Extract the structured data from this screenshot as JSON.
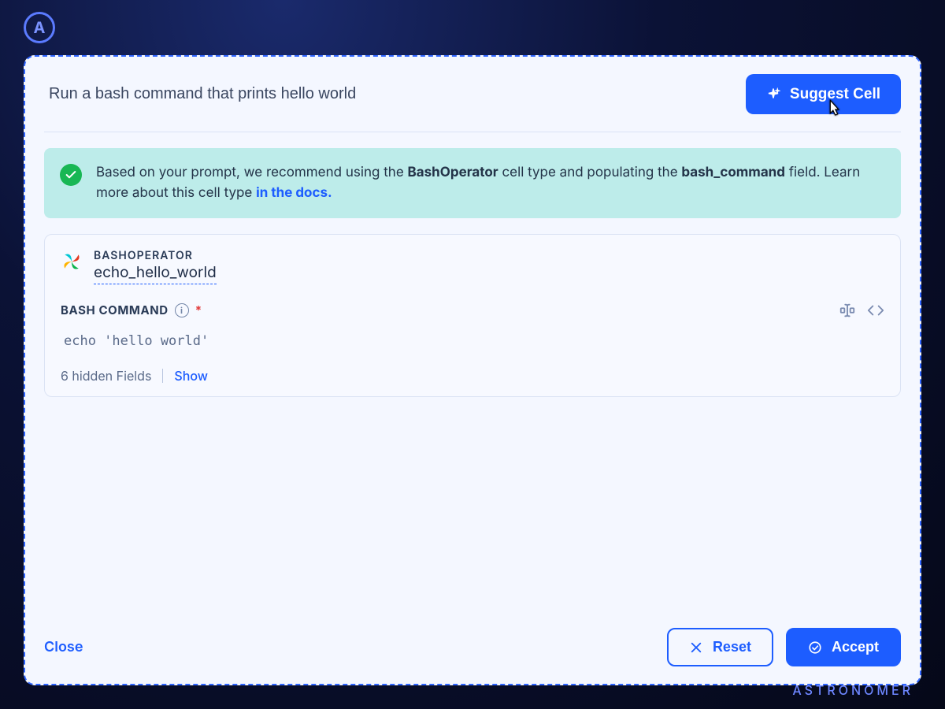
{
  "brand": {
    "logo_letter": "A",
    "footer_text": "ASTRONOMER"
  },
  "prompt": {
    "value": "Run a bash command that prints hello world",
    "suggest_label": "Suggest Cell"
  },
  "recommendation": {
    "prefix": "Based on your prompt, we recommend using the ",
    "cell_type_bold": "BashOperator",
    "mid1": " cell type and populating the ",
    "field_bold": "bash_command",
    "mid2": " field. Learn more about this cell type ",
    "link_text": "in the docs."
  },
  "cell": {
    "type_label": "BASHOPERATOR",
    "task_name": "echo_hello_world",
    "field": {
      "label": "BASH COMMAND",
      "required_mark": "*",
      "value": "echo 'hello world'"
    },
    "hidden_fields_text": "6 hidden Fields",
    "show_link": "Show"
  },
  "footer": {
    "close": "Close",
    "reset": "Reset",
    "accept": "Accept"
  }
}
